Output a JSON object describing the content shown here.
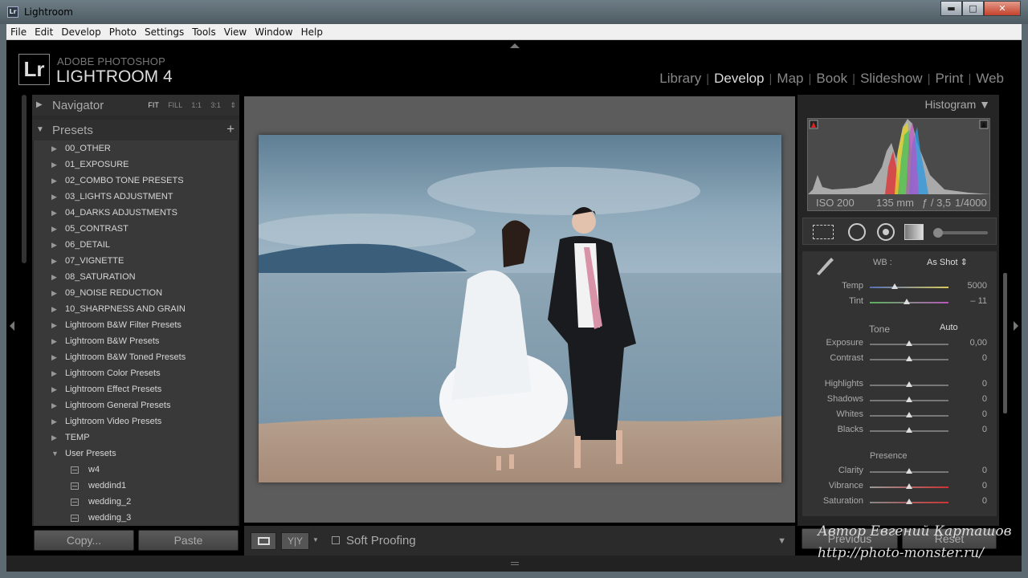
{
  "window": {
    "title": "Lightroom",
    "minimize": "▬",
    "maximize": "□",
    "close": "✕"
  },
  "menu": [
    "File",
    "Edit",
    "Develop",
    "Photo",
    "Settings",
    "Tools",
    "View",
    "Window",
    "Help"
  ],
  "brand": {
    "logo": "Lr",
    "line1": "ADOBE PHOTOSHOP",
    "line2": "LIGHTROOM 4"
  },
  "modules": [
    {
      "label": "Library",
      "active": false
    },
    {
      "label": "Develop",
      "active": true
    },
    {
      "label": "Map",
      "active": false
    },
    {
      "label": "Book",
      "active": false
    },
    {
      "label": "Slideshow",
      "active": false
    },
    {
      "label": "Print",
      "active": false
    },
    {
      "label": "Web",
      "active": false
    }
  ],
  "navigator": {
    "title": "Navigator",
    "options": [
      "FIT",
      "FILL",
      "1:1",
      "3:1"
    ],
    "active_option": "FIT",
    "menu_arrow": "⇕"
  },
  "presets": {
    "title": "Presets",
    "add": "+",
    "folders": [
      "00_OTHER",
      "01_EXPOSURE",
      "02_COMBO TONE PRESETS",
      "03_LIGHTS ADJUSTMENT",
      "04_DARKS ADJUSTMENTS",
      "05_CONTRAST",
      "06_DETAIL",
      "07_VIGNETTE",
      "08_SATURATION",
      "09_NOISE REDUCTION",
      "10_SHARPNESS AND GRAIN",
      "Lightroom B&W Filter Presets",
      "Lightroom B&W Presets",
      "Lightroom B&W Toned Presets",
      "Lightroom Color Presets",
      "Lightroom Effect Presets",
      "Lightroom General Presets",
      "Lightroom Video Presets",
      "TEMP"
    ],
    "open_folder": "User Presets",
    "user_presets": [
      "w4",
      "weddind1",
      "wedding_2",
      "wedding_3"
    ]
  },
  "left_buttons": {
    "copy": "Copy...",
    "paste": "Paste"
  },
  "toolbar": {
    "soft_proofing": "Soft Proofing",
    "view_yy": "Y|Y"
  },
  "histogram": {
    "title": "Histogram",
    "iso": "ISO 200",
    "focal": "135 mm",
    "aperture": "ƒ / 3,5",
    "shutter": "1/4000"
  },
  "basic": {
    "wb_label": "WB :",
    "wb_value": "As Shot",
    "tone_label": "Tone",
    "auto_label": "Auto",
    "presence_label": "Presence",
    "sliders": [
      {
        "label": "Temp",
        "value": "5000",
        "pos": 0.32
      },
      {
        "label": "Tint",
        "value": "– 11",
        "pos": 0.47
      },
      {
        "label": "Exposure",
        "value": "0,00",
        "pos": 0.5
      },
      {
        "label": "Contrast",
        "value": "0",
        "pos": 0.5
      },
      {
        "label": "Highlights",
        "value": "0",
        "pos": 0.5
      },
      {
        "label": "Shadows",
        "value": "0",
        "pos": 0.5
      },
      {
        "label": "Whites",
        "value": "0",
        "pos": 0.5
      },
      {
        "label": "Blacks",
        "value": "0",
        "pos": 0.5
      },
      {
        "label": "Clarity",
        "value": "0",
        "pos": 0.5
      },
      {
        "label": "Vibrance",
        "value": "0",
        "pos": 0.5
      },
      {
        "label": "Saturation",
        "value": "0",
        "pos": 0.5
      }
    ]
  },
  "right_buttons": {
    "previous": "Previous",
    "reset": "Reset"
  },
  "watermark": {
    "line1": "Автор Евгений Карташов",
    "line2": "http://photo-monster.ru/"
  },
  "colors": {
    "accent": "#dddddd",
    "panel": "#2a2a2a",
    "background": "#5c5c5c"
  }
}
